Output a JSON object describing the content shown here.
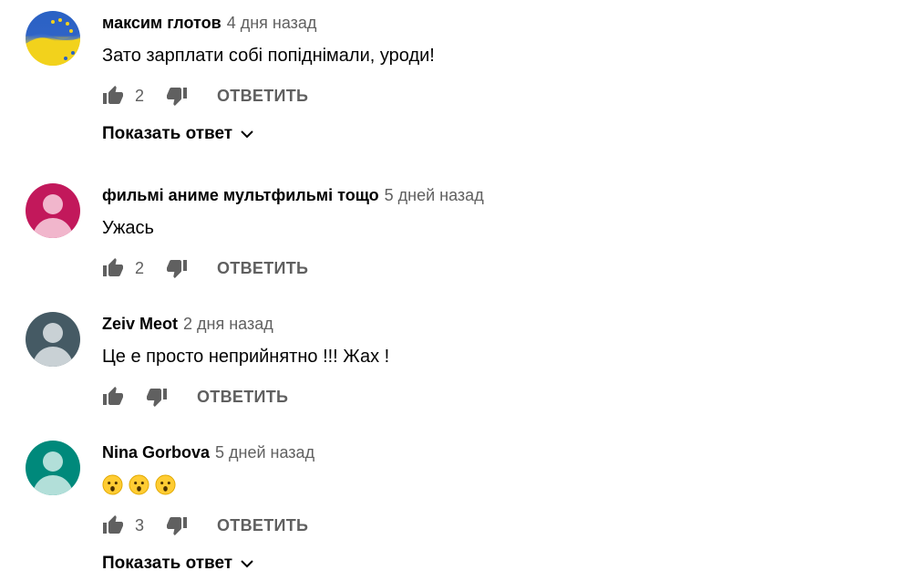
{
  "comments": [
    {
      "author": "максим глотов",
      "time": "4 дня назад",
      "text": "Зато зарплати собі попіднімали, уроди!",
      "likes": "2",
      "reply_label": "ОТВЕТИТЬ",
      "show_replies": "Показать ответ",
      "avatar": "flag-avatar"
    },
    {
      "author": "фильмі аниме мультфильмі тощо",
      "time": "5 дней назад",
      "text": "Ужась",
      "likes": "2",
      "reply_label": "ОТВЕТИТЬ",
      "avatar_color": "#c2185b",
      "avatar_light": "#f1b6cc"
    },
    {
      "author": "Zeiv Meot",
      "time": "2 дня назад",
      "text": "Це е просто неприйнятно !!! Жах !",
      "likes": "",
      "reply_label": "ОТВЕТИТЬ",
      "avatar_color": "#455a64",
      "avatar_light": "#c9d1d5"
    },
    {
      "author": "Nina Gorbova",
      "time": "5 дней назад",
      "emoji": [
        "hushed-face",
        "hushed-face",
        "hushed-face"
      ],
      "likes": "3",
      "reply_label": "ОТВЕТИТЬ",
      "show_replies": "Показать ответ",
      "avatar_color": "#00897b",
      "avatar_light": "#b2dfd9"
    }
  ],
  "colors": {
    "secondary_text": "#606060",
    "icon": "#606060"
  }
}
